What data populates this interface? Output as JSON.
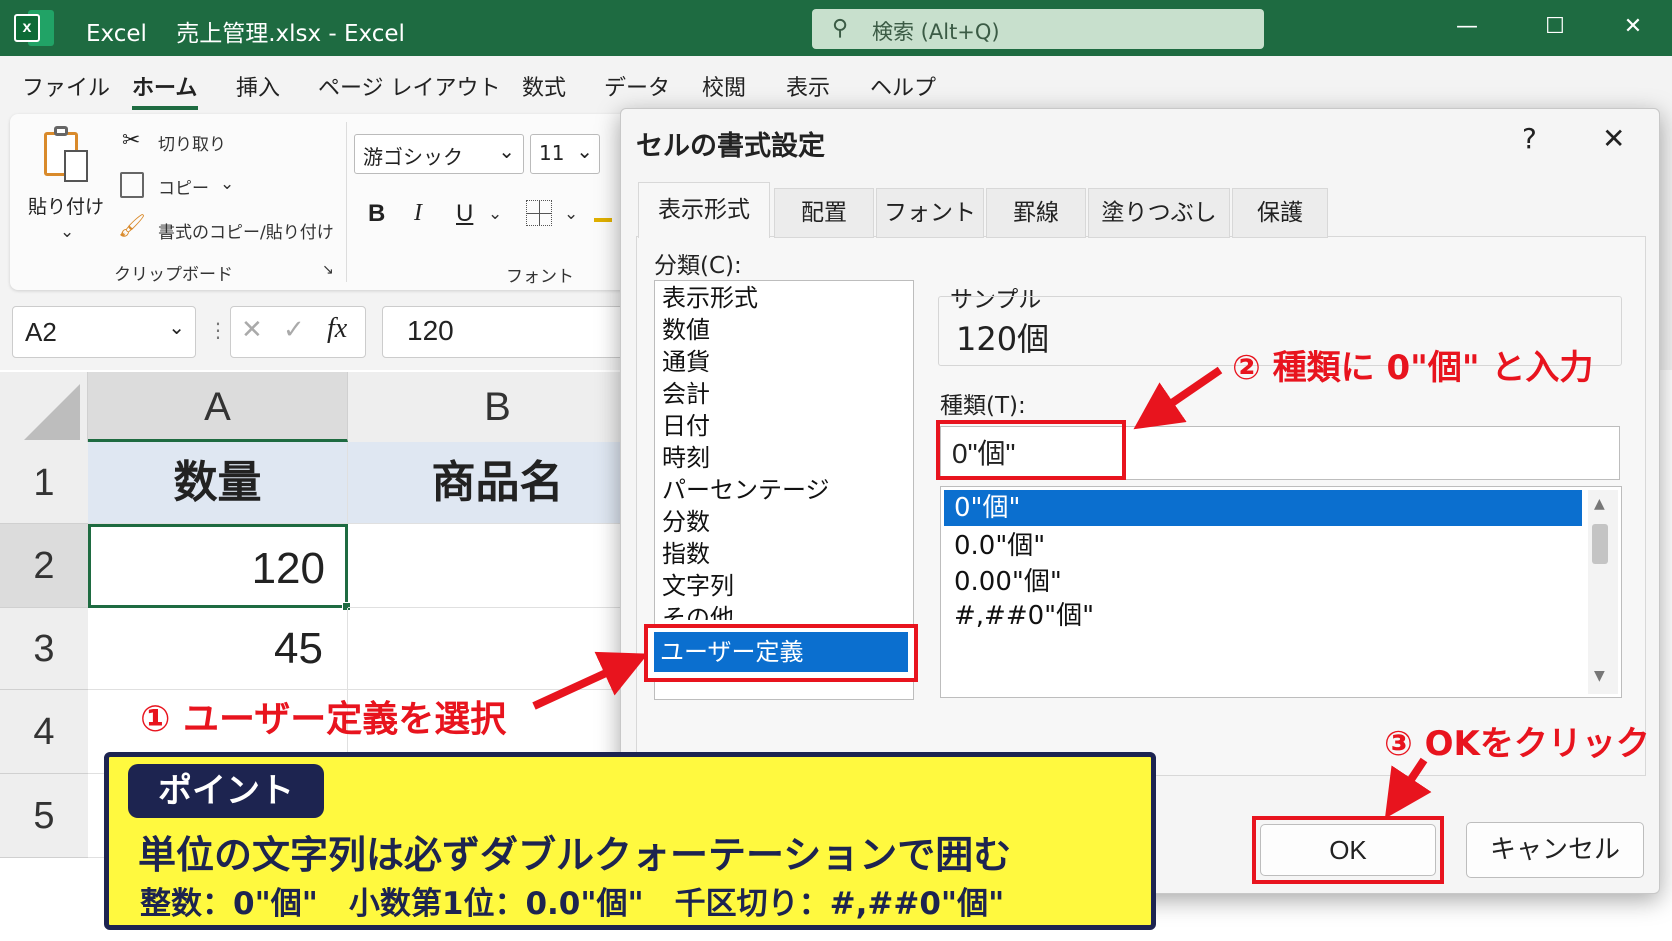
{
  "titlebar": {
    "app_name": "Excel",
    "document": "売上管理.xlsx - Excel",
    "search_placeholder": "検索 (Alt+Q)",
    "logo_letter": "x"
  },
  "menu": [
    "ファイル",
    "ホーム",
    "挿入",
    "ページ レイアウト",
    "数式",
    "データ",
    "校閲",
    "表示",
    "ヘルプ"
  ],
  "ribbon": {
    "paste_label": "貼り付け",
    "cut": "切り取り",
    "copy": "コピー",
    "format_painter": "書式のコピー/貼り付け",
    "clipboard_group": "クリップボード",
    "font_name": "游ゴシック",
    "font_size": "11",
    "bold": "B",
    "italic": "I",
    "underline": "U",
    "font_group": "フォント"
  },
  "formula_bar": {
    "name_box": "A2",
    "fx": "fx",
    "value": "120"
  },
  "sheet": {
    "columns": [
      "A",
      "B"
    ],
    "rows": [
      "1",
      "2",
      "3",
      "4",
      "5"
    ],
    "a1": "数量",
    "b1": "商品名",
    "a2": "120",
    "a3": "45"
  },
  "dialog": {
    "title": "セルの書式設定",
    "help": "?",
    "close": "✕",
    "tabs": [
      "表示形式",
      "配置",
      "フォント",
      "罫線",
      "塗りつぶし",
      "保護"
    ],
    "category_label": "分類(C):",
    "categories": [
      "表示形式",
      "数値",
      "通貨",
      "会計",
      "日付",
      "時刻",
      "パーセンテージ",
      "分数",
      "指数",
      "文字列",
      "その他"
    ],
    "selected_category": "ユーザー定義",
    "sample_label": "サンプル",
    "sample_value": "120個",
    "type_label": "種類(T):",
    "type_value": "0\"個\"",
    "type_list": [
      "0\"個\"",
      "0.0\"個\"",
      "0.00\"個\"",
      "#,##0\"個\""
    ],
    "ok": "OK",
    "cancel": "キャンセル"
  },
  "annotations": {
    "step1": "① ユーザー定義を選択",
    "step2": "② 種類に 0\"個\" と入力",
    "step3": "③ OKをクリック"
  },
  "tip": {
    "badge": "ポイント",
    "main": "単位の文字列は必ずダブルクォーテーションで囲む",
    "sub": "整数：0\"個\"　小数第1位：0.0\"個\"　千区切り：#,##0\"個\""
  },
  "colors": {
    "excel_green": "#1e6b41",
    "annotation_red": "#e8141e",
    "tip_yellow": "#fff93f",
    "tip_navy": "#1d2450",
    "selection_blue": "#0b6fcf"
  }
}
